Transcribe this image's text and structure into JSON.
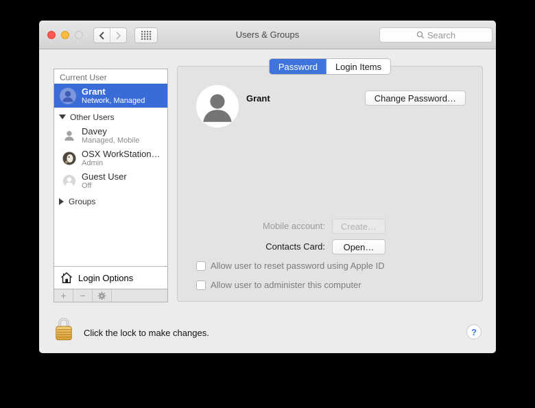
{
  "titlebar": {
    "title": "Users & Groups",
    "search_placeholder": "Search"
  },
  "tabs": [
    {
      "label": "Password",
      "active": true
    },
    {
      "label": "Login Items",
      "active": false
    }
  ],
  "sidebar": {
    "current_user_header": "Current User",
    "current_user": {
      "name": "Grant",
      "subtitle": "Network, Managed"
    },
    "other_users_header": "Other Users",
    "other_users": [
      {
        "name": "Davey",
        "subtitle": "Managed, Mobile"
      },
      {
        "name": "OSX WorkStation…",
        "subtitle": "Admin"
      },
      {
        "name": "Guest User",
        "subtitle": "Off"
      }
    ],
    "groups_header": "Groups",
    "login_options_label": "Login Options",
    "toolbar": {
      "add": "+",
      "remove": "−",
      "gear": "gear-icon"
    }
  },
  "main": {
    "user_name": "Grant",
    "change_password_button": "Change Password…",
    "mobile_account_label": "Mobile account:",
    "create_button": "Create…",
    "contacts_card_label": "Contacts Card:",
    "open_button": "Open…",
    "checkboxes": [
      {
        "label": "Allow user to reset password using Apple ID",
        "checked": false
      },
      {
        "label": "Allow user to administer this computer",
        "checked": false
      }
    ]
  },
  "footer": {
    "lock_message": "Click the lock to make changes.",
    "help_label": "?"
  },
  "colors": {
    "selection_blue": "#3a6cd8",
    "tab_active_blue": "#3f74dc",
    "help_blue": "#3b77d8",
    "lock_gold": "#e2a43c"
  }
}
